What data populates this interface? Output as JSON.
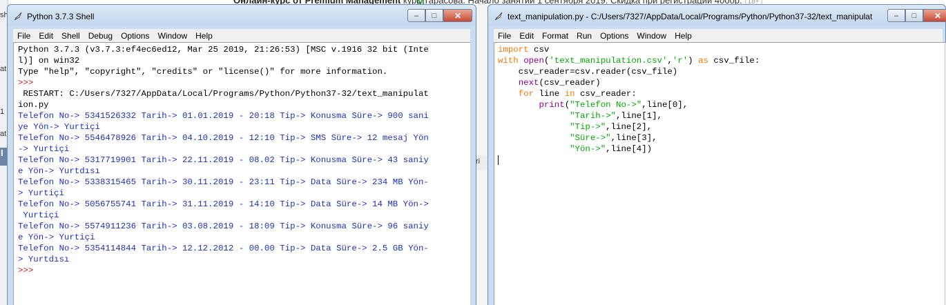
{
  "background": {
    "banner_bold": "Онлайн-курс от Premium Management",
    "banner_text": " курс Тарасова. Начало занятий 1 сентября 2019. Скидка при регистрации 4000р.",
    "banner_badge": "18+",
    "left_fragments": [
      "sh",
      "at",
      "1",
      "at"
    ],
    "left_blue": "I",
    "mid_fragment": "ri"
  },
  "shell": {
    "title": "Python 3.7.3 Shell",
    "menu": [
      "File",
      "Edit",
      "Shell",
      "Debug",
      "Options",
      "Window",
      "Help"
    ],
    "lines": [
      {
        "text": "Python 3.7.3 (v3.7.3:ef4ec6ed12, Mar 25 2019, 21:26:53) [MSC v.1916 32 bit (Inte",
        "kind": "black"
      },
      {
        "text": "l)] on win32",
        "kind": "black"
      },
      {
        "text": "Type \"help\", \"copyright\", \"credits\" or \"license()\" for more information.",
        "kind": "black"
      },
      {
        "text": ">>> ",
        "kind": "prompt"
      },
      {
        "text": " RESTART: C:/Users/7327/AppData/Local/Programs/Python/Python37-32/text_manipulat",
        "kind": "black"
      },
      {
        "text": "ion.py",
        "kind": "black"
      },
      {
        "text": "Telefon No-> 5341526332 Tarih-> 01.01.2019 - 20:18 Tip-> Konusma Süre-> 900 sani",
        "kind": "blue"
      },
      {
        "text": "ye Yön-> Yurtiçi",
        "kind": "blue"
      },
      {
        "text": "Telefon No-> 5546478926 Tarih-> 04.10.2019 - 12:10 Tip-> SMS Süre-> 12 mesaj Yön",
        "kind": "blue"
      },
      {
        "text": "-> Yurtiçi",
        "kind": "blue"
      },
      {
        "text": "Telefon No-> 5317719901 Tarih-> 22.11.2019 - 08.02 Tip-> Konusma Süre-> 43 saniy",
        "kind": "blue"
      },
      {
        "text": "e Yön-> Yurtdısı",
        "kind": "blue"
      },
      {
        "text": "Telefon No-> 5338315465 Tarih-> 30.11.2019 - 23:11 Tip-> Data Süre-> 234 MB Yön-",
        "kind": "blue"
      },
      {
        "text": "> Yurtiçi",
        "kind": "blue"
      },
      {
        "text": "Telefon No-> 5056755741 Tarih-> 31.11.2019 - 14:10 Tip-> Data Süre-> 14 MB Yön->",
        "kind": "blue"
      },
      {
        "text": " Yurtiçi",
        "kind": "blue"
      },
      {
        "text": "Telefon No-> 5574911236 Tarih-> 03.08.2019 - 18:09 Tip-> Konusma Süre-> 96 saniy",
        "kind": "blue"
      },
      {
        "text": "e Yön-> Yurtiçi",
        "kind": "blue"
      },
      {
        "text": "Telefon No-> 5354114844 Tarih-> 12.12.2012 - 00.00 Tip-> Data Süre-> 2.5 GB Yön-",
        "kind": "blue"
      },
      {
        "text": "> Yurtdısı",
        "kind": "blue"
      },
      {
        "text": ">>> ",
        "kind": "prompt"
      }
    ]
  },
  "editor": {
    "title": "text_manipulation.py - C:/Users/7327/AppData/Local/Programs/Python/Python37-32/text_manipulat",
    "menu": [
      "File",
      "Edit",
      "Format",
      "Run",
      "Options",
      "Window",
      "Help"
    ],
    "code": [
      [
        {
          "t": "import",
          "c": "kw"
        },
        {
          "t": " csv",
          "c": "plain"
        }
      ],
      [
        {
          "t": "with",
          "c": "kw"
        },
        {
          "t": " ",
          "c": "plain"
        },
        {
          "t": "open",
          "c": "bi"
        },
        {
          "t": "(",
          "c": "plain"
        },
        {
          "t": "'text_manipulation.csv'",
          "c": "str"
        },
        {
          "t": ",",
          "c": "plain"
        },
        {
          "t": "'r'",
          "c": "str"
        },
        {
          "t": ") ",
          "c": "plain"
        },
        {
          "t": "as",
          "c": "kw"
        },
        {
          "t": " csv_file:",
          "c": "plain"
        }
      ],
      [
        {
          "t": "    csv_reader=csv.reader(csv_file)",
          "c": "plain"
        }
      ],
      [
        {
          "t": "    ",
          "c": "plain"
        },
        {
          "t": "next",
          "c": "bi"
        },
        {
          "t": "(csv_reader)",
          "c": "plain"
        }
      ],
      [
        {
          "t": "    ",
          "c": "plain"
        },
        {
          "t": "for",
          "c": "kw"
        },
        {
          "t": " line ",
          "c": "plain"
        },
        {
          "t": "in",
          "c": "kw"
        },
        {
          "t": " csv_reader:",
          "c": "plain"
        }
      ],
      [
        {
          "t": "        ",
          "c": "plain"
        },
        {
          "t": "print",
          "c": "bi"
        },
        {
          "t": "(",
          "c": "plain"
        },
        {
          "t": "\"Telefon No->\"",
          "c": "str"
        },
        {
          "t": ",line[0],",
          "c": "plain"
        }
      ],
      [
        {
          "t": "              ",
          "c": "plain"
        },
        {
          "t": "\"Tarih->\"",
          "c": "str"
        },
        {
          "t": ",line[1],",
          "c": "plain"
        }
      ],
      [
        {
          "t": "              ",
          "c": "plain"
        },
        {
          "t": "\"Tip->\"",
          "c": "str"
        },
        {
          "t": ",line[2],",
          "c": "plain"
        }
      ],
      [
        {
          "t": "              ",
          "c": "plain"
        },
        {
          "t": "\"Süre->\"",
          "c": "str"
        },
        {
          "t": ",line[3],",
          "c": "plain"
        }
      ],
      [
        {
          "t": "              ",
          "c": "plain"
        },
        {
          "t": "\"Yön->\"",
          "c": "str"
        },
        {
          "t": ",line[4])",
          "c": "plain"
        }
      ],
      []
    ]
  },
  "window_controls": {
    "minimize": "–",
    "maximize": "□",
    "close": "✕"
  },
  "colors": {
    "keyword": "#ff7700",
    "string": "#00aa00",
    "builtin": "#900090",
    "output": "#1f2fc7",
    "prompt": "#c02020"
  }
}
